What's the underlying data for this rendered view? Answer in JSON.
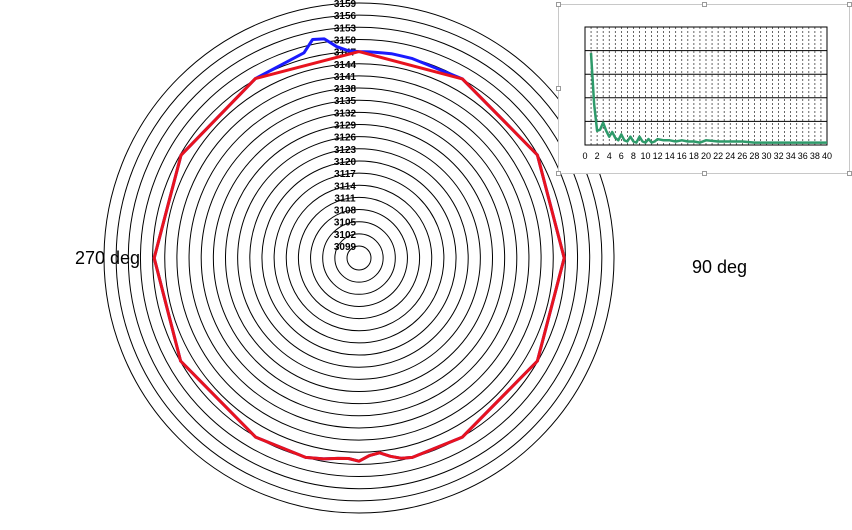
{
  "polar_chart": {
    "left_angle_label": "270 deg",
    "right_angle_label": "90 deg"
  },
  "inset_chart": {
    "x_tick_labels": [
      "0",
      "2",
      "4",
      "6",
      "8",
      "10",
      "12",
      "14",
      "16",
      "18",
      "20",
      "22",
      "24",
      "26",
      "28",
      "30",
      "32",
      "34",
      "36",
      "38",
      "40"
    ]
  },
  "colors": {
    "ring": "#000000",
    "series_blue": "#1a1aff",
    "series_red": "#e8131e",
    "spectrum_green": "#2e9a6a",
    "inset_border": "#c8c8c8"
  },
  "chart_data": [
    {
      "type": "line",
      "subtype": "polar",
      "radial_tick_labels": [
        "3099",
        "3102",
        "3105",
        "3108",
        "3111",
        "3114",
        "3117",
        "3120",
        "3123",
        "3126",
        "3129",
        "3132",
        "3135",
        "3138",
        "3141",
        "3144",
        "3147",
        "3150",
        "3153",
        "3156",
        "3159"
      ],
      "r_range": [
        3099,
        3159
      ],
      "angle_labels": [
        "270 deg",
        "90 deg"
      ],
      "angle_units": "deg",
      "series": [
        {
          "color": "#1a1aff",
          "theta": [
            0,
            3,
            6,
            9,
            12,
            15,
            30,
            60,
            90,
            120,
            150,
            165,
            170,
            174,
            177,
            180,
            183,
            186,
            189,
            192,
            195,
            210,
            240,
            270,
            300,
            330,
            345,
            348,
            351,
            354,
            357,
            360
          ],
          "r": [
            3147,
            3147.3,
            3148.5,
            3150.8,
            3151.2,
            3148.5,
            3147.2,
            3146.8,
            3146.6,
            3146.9,
            3147.1,
            3147.0,
            3146.4,
            3145.8,
            3145.6,
            3146.2,
            3144.9,
            3144.4,
            3145.6,
            3146.6,
            3147.0,
            3147.1,
            3146.9,
            3146.7,
            3146.9,
            3147.1,
            3147.0,
            3147.0,
            3147.1,
            3147.0,
            3147.0,
            3147
          ]
        },
        {
          "color": "#e8131e",
          "theta": [
            0,
            30,
            60,
            90,
            120,
            150,
            165,
            170,
            174,
            177,
            180,
            183,
            186,
            189,
            192,
            195,
            210,
            240,
            270,
            300,
            330,
            360
          ],
          "r": [
            3147,
            3147.2,
            3146.8,
            3146.6,
            3146.9,
            3147.1,
            3147.0,
            3146.4,
            3145.8,
            3145.6,
            3146.2,
            3144.9,
            3144.4,
            3145.6,
            3146.6,
            3147.0,
            3147.1,
            3146.9,
            3146.7,
            3146.9,
            3147.1,
            3147
          ]
        }
      ],
      "grid": true
    },
    {
      "type": "line",
      "x_tick_labels": [
        "0",
        "2",
        "4",
        "6",
        "8",
        "10",
        "12",
        "14",
        "16",
        "18",
        "20",
        "22",
        "24",
        "26",
        "28",
        "30",
        "32",
        "34",
        "36",
        "38",
        "40"
      ],
      "xlim": [
        0,
        40
      ],
      "ylim": [
        0,
        1
      ],
      "grid": true,
      "series": [
        {
          "color": "#2e9a6a",
          "x": [
            1,
            1.5,
            2,
            2.5,
            3,
            3.5,
            4,
            4.5,
            5,
            5.5,
            6,
            6.5,
            7,
            7.5,
            8,
            8.5,
            9,
            9.5,
            10,
            10.5,
            11,
            11.5,
            12,
            13,
            14,
            15,
            16,
            17,
            18,
            19,
            20,
            22,
            24,
            26,
            28,
            30,
            32,
            34,
            36,
            38,
            40
          ],
          "y": [
            0.78,
            0.35,
            0.12,
            0.13,
            0.19,
            0.12,
            0.07,
            0.11,
            0.06,
            0.04,
            0.09,
            0.04,
            0.03,
            0.07,
            0.03,
            0.02,
            0.07,
            0.03,
            0.02,
            0.05,
            0.02,
            0.03,
            0.05,
            0.04,
            0.04,
            0.03,
            0.04,
            0.03,
            0.03,
            0.02,
            0.04,
            0.03,
            0.03,
            0.03,
            0.02,
            0.02,
            0.02,
            0.02,
            0.02,
            0.02,
            0.02
          ]
        }
      ]
    }
  ]
}
